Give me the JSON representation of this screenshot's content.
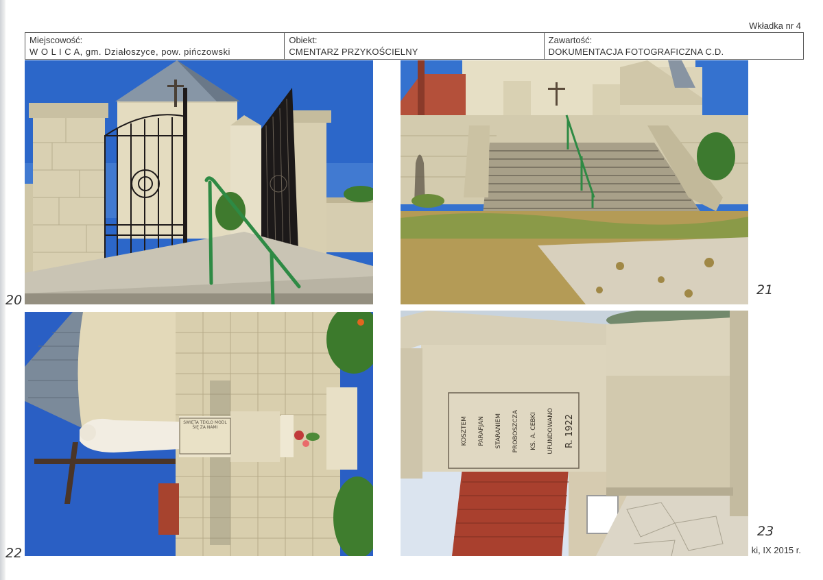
{
  "insert_label": "Wkładka nr 4",
  "header": {
    "location_label": "Miejscowość:",
    "location_value": "W O L I C A, gm. Działoszyce, pow. pińczowski",
    "object_label": "Obiekt:",
    "object_value": "CMENTARZ PRZYKOŚCIELNY",
    "content_label": "Zawartość:",
    "content_value": "DOKUMENTACJA FOTOGRAFICZNA C.D."
  },
  "photos": [
    {
      "number": "20"
    },
    {
      "number": "21"
    },
    {
      "number": "22",
      "plaque_text": "ŚWIĘTA TEKLO MÓDL SIĘ ZA NAMI"
    },
    {
      "number": "23",
      "inscription": [
        "KOSZTEM",
        "PARAFJAN",
        "STARANIEM",
        "PROBOSZCZA",
        "KS. A. CEBKI",
        "UFUNDOWANO",
        "R. 1922"
      ]
    }
  ],
  "footer_date": "ki, IX 2015 r.",
  "colors": {
    "sky": "#2a66c8",
    "limestone": "#dcd3b6",
    "roof_slate": "#7f8e9e",
    "rail_green": "#2e8a44",
    "grass": "#b59d55"
  }
}
